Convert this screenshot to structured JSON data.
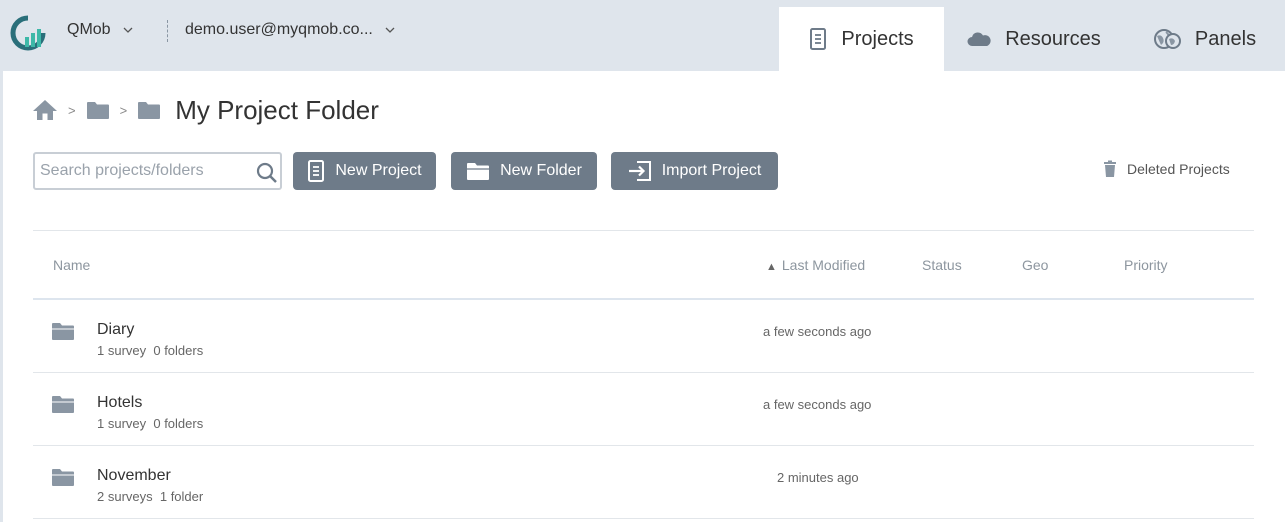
{
  "header": {
    "org": "QMob",
    "user": "demo.user@myqmob.co...",
    "tabs": [
      {
        "label": "Projects",
        "active": true,
        "icon": "document-icon"
      },
      {
        "label": "Resources",
        "active": false,
        "icon": "cloud-icon"
      },
      {
        "label": "Panels",
        "active": false,
        "icon": "globe-icon"
      }
    ]
  },
  "breadcrumb": {
    "separators": [
      ">",
      ">"
    ],
    "current": "My Project Folder"
  },
  "toolbar": {
    "search_placeholder": "Search projects/folders",
    "new_project": "New Project",
    "new_folder": "New Folder",
    "import_project": "Import Project",
    "deleted_projects": "Deleted Projects"
  },
  "table": {
    "columns": {
      "name": "Name",
      "last_modified": "Last Modified",
      "status": "Status",
      "geo": "Geo",
      "priority": "Priority"
    },
    "sort_indicator": "▲",
    "rows": [
      {
        "name": "Diary",
        "meta": "1 survey  0 folders",
        "modified": "a few seconds ago"
      },
      {
        "name": "Hotels",
        "meta": "1 survey  0 folders",
        "modified": "a few seconds ago"
      },
      {
        "name": "November",
        "meta": "2 surveys  1 folder",
        "modified": "2 minutes ago"
      }
    ]
  },
  "colors": {
    "accent": "#2a8f8a",
    "button": "#6e7b89",
    "header_bg": "#dfe5ec",
    "icon_gray": "#8a96a3"
  }
}
